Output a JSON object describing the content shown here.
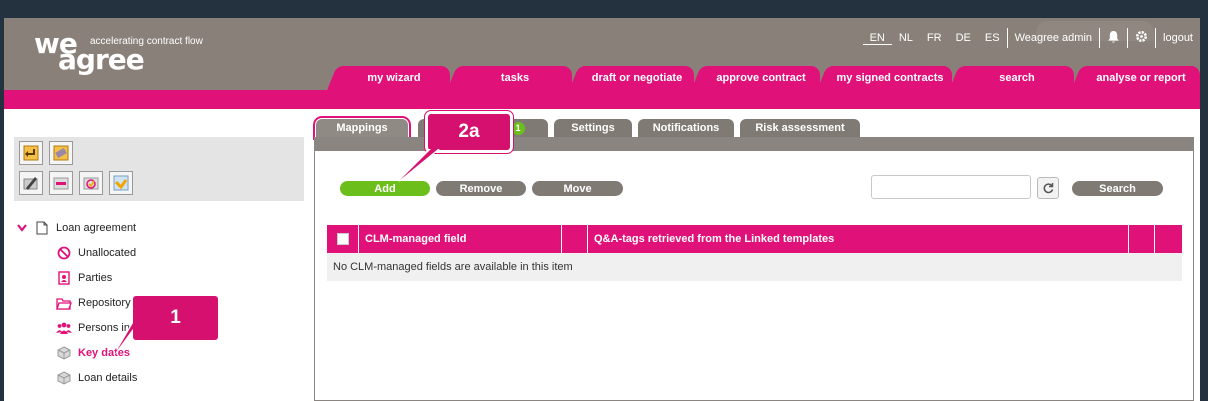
{
  "logo": {
    "we": "we",
    "agree": "agree",
    "tagline": "accelerating contract flow"
  },
  "topnav": {
    "lang_en": "EN",
    "lang_nl": "NL",
    "lang_fr": "FR",
    "lang_de": "DE",
    "lang_es": "ES",
    "user": "Weagree admin",
    "logout": "logout"
  },
  "navtabs": [
    "my wizard",
    "tasks",
    "draft or negotiate",
    "approve contract",
    "my signed contracts",
    "search",
    "analyse or report"
  ],
  "tree": {
    "root": "Loan agreement",
    "items": [
      "Unallocated",
      "Parties",
      "Repository",
      "Persons in c",
      "Key dates",
      "Loan details"
    ]
  },
  "subtabs": {
    "mappings": "Mappings",
    "badge": "1",
    "settings": "Settings",
    "notifications": "Notifications",
    "risk": "Risk assessment"
  },
  "toolbar": {
    "add": "Add",
    "remove": "Remove",
    "move": "Move",
    "search": "Search",
    "search_value": ""
  },
  "table": {
    "col1": "CLM-managed field",
    "col2": "Q&A-tags retrieved from the Linked templates",
    "empty": "No CLM-managed fields are available in this item"
  },
  "callouts": {
    "one": "1",
    "two_a": "2a"
  },
  "colors": {
    "accent": "#e0127a",
    "header": "#898179",
    "green": "#6cbf1a"
  }
}
